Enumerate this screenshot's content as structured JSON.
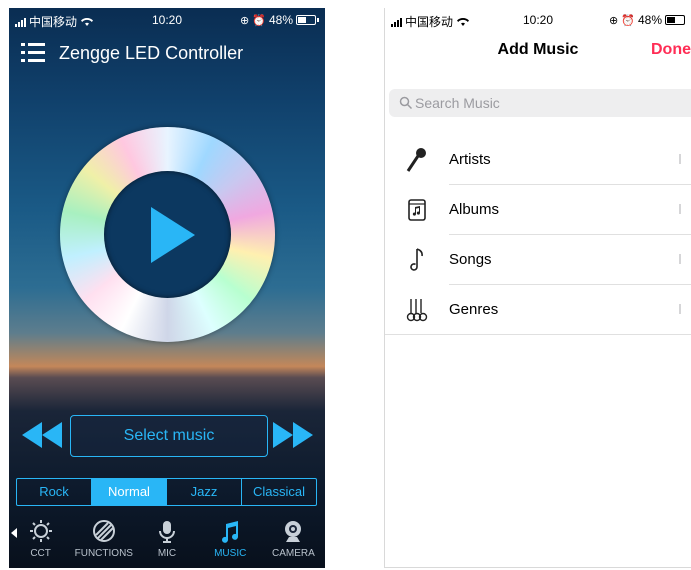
{
  "left": {
    "status": {
      "carrier": "中国移动",
      "time": "10:20",
      "battery": "48%"
    },
    "app_title": "Zengge LED Controller",
    "select_music_label": "Select music",
    "genres": [
      {
        "label": "Rock",
        "active": false
      },
      {
        "label": "Normal",
        "active": true
      },
      {
        "label": "Jazz",
        "active": false
      },
      {
        "label": "Classical",
        "active": false
      }
    ],
    "tabs": [
      {
        "label": "CCT",
        "icon": "sun-icon",
        "active": false
      },
      {
        "label": "FUNCTIONS",
        "icon": "pattern-icon",
        "active": false
      },
      {
        "label": "MIC",
        "icon": "microphone-icon",
        "active": false
      },
      {
        "label": "MUSIC",
        "icon": "music-note-icon",
        "active": true
      },
      {
        "label": "CAMERA",
        "icon": "camera-icon",
        "active": false
      }
    ],
    "accent_color": "#29b6f6"
  },
  "right": {
    "status": {
      "carrier": "中国移动",
      "time": "10:20",
      "battery": "48%"
    },
    "nav_title": "Add Music",
    "done_label": "Done",
    "search_placeholder": "Search Music",
    "items": [
      {
        "label": "Artists",
        "icon": "microphone-icon"
      },
      {
        "label": "Albums",
        "icon": "album-icon"
      },
      {
        "label": "Songs",
        "icon": "music-note-icon"
      },
      {
        "label": "Genres",
        "icon": "guitars-icon"
      }
    ],
    "done_color": "#ff2d55"
  }
}
